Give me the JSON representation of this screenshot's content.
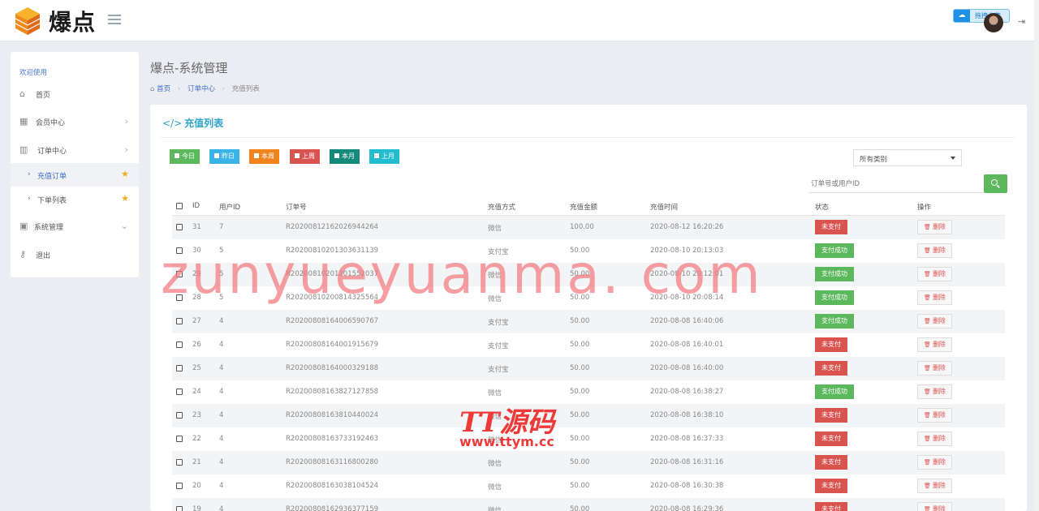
{
  "header": {
    "logo_text": "爆点",
    "upload_label": "拖拽上传",
    "logout_icon": "logout-icon"
  },
  "sidebar": {
    "welcome": "欢迎使用",
    "items": [
      {
        "label": "首页",
        "icon": "home-icon"
      },
      {
        "label": "会员中心",
        "icon": "table-icon"
      },
      {
        "label": "订单中心",
        "icon": "bar-chart-icon"
      },
      {
        "label": "系统管理",
        "icon": "window-icon"
      },
      {
        "label": "退出",
        "icon": "key-icon"
      }
    ],
    "sub_items": [
      {
        "label": "充值订单",
        "active": true
      },
      {
        "label": "下单列表",
        "active": false
      }
    ]
  },
  "page": {
    "title": "爆点-系统管理",
    "breadcrumb": {
      "home": "首页",
      "section": "订单中心",
      "current": "充值列表"
    }
  },
  "panel": {
    "title": "充值列表",
    "filters": [
      {
        "label": "今日",
        "color": "#5cb85c"
      },
      {
        "label": "昨日",
        "color": "#3ab4e6"
      },
      {
        "label": "本周",
        "color": "#f0831e"
      },
      {
        "label": "上周",
        "color": "#d9534f"
      },
      {
        "label": "本月",
        "color": "#138a7c"
      },
      {
        "label": "上月",
        "color": "#24bccf"
      }
    ],
    "type_select": "所有类别",
    "search_placeholder": "订单号或用户ID",
    "columns": [
      "ID",
      "用户ID",
      "订单号",
      "充值方式",
      "充值金额",
      "充值时间",
      "状态",
      "操作"
    ],
    "delete_label": "删除",
    "rows": [
      {
        "id": "31",
        "uid": "7",
        "order": "R20200812162026944264",
        "method": "微信",
        "amount": "100.00",
        "time": "2020-08-12 16:20:26",
        "status": "未支付",
        "paid": false
      },
      {
        "id": "30",
        "uid": "5",
        "order": "R20200810201303631139",
        "method": "支付宝",
        "amount": "50.00",
        "time": "2020-08-10 20:13:03",
        "status": "支付成功",
        "paid": true
      },
      {
        "id": "29",
        "uid": "5",
        "order": "R20200810201201552037",
        "method": "微信",
        "amount": "50.00",
        "time": "2020-08-10 20:12:01",
        "status": "支付成功",
        "paid": true
      },
      {
        "id": "28",
        "uid": "5",
        "order": "R20200810200814325564",
        "method": "微信",
        "amount": "50.00",
        "time": "2020-08-10 20:08:14",
        "status": "支付成功",
        "paid": true
      },
      {
        "id": "27",
        "uid": "4",
        "order": "R20200808164006590767",
        "method": "支付宝",
        "amount": "50.00",
        "time": "2020-08-08 16:40:06",
        "status": "支付成功",
        "paid": true
      },
      {
        "id": "26",
        "uid": "4",
        "order": "R20200808164001915679",
        "method": "支付宝",
        "amount": "50.00",
        "time": "2020-08-08 16:40:01",
        "status": "未支付",
        "paid": false
      },
      {
        "id": "25",
        "uid": "4",
        "order": "R20200808164000329188",
        "method": "支付宝",
        "amount": "50.00",
        "time": "2020-08-08 16:40:00",
        "status": "未支付",
        "paid": false
      },
      {
        "id": "24",
        "uid": "4",
        "order": "R20200808163827127858",
        "method": "微信",
        "amount": "50.00",
        "time": "2020-08-08 16:38:27",
        "status": "支付成功",
        "paid": true
      },
      {
        "id": "23",
        "uid": "4",
        "order": "R20200808163810440024",
        "method": "微信",
        "amount": "50.00",
        "time": "2020-08-08 16:38:10",
        "status": "未支付",
        "paid": false
      },
      {
        "id": "22",
        "uid": "4",
        "order": "R20200808163733192463",
        "method": "微信",
        "amount": "50.00",
        "time": "2020-08-08 16:37:33",
        "status": "未支付",
        "paid": false
      },
      {
        "id": "21",
        "uid": "4",
        "order": "R20200808163116800280",
        "method": "微信",
        "amount": "50.00",
        "time": "2020-08-08 16:31:16",
        "status": "未支付",
        "paid": false
      },
      {
        "id": "20",
        "uid": "4",
        "order": "R20200808163038104524",
        "method": "微信",
        "amount": "50.00",
        "time": "2020-08-08 16:30:38",
        "status": "未支付",
        "paid": false
      },
      {
        "id": "19",
        "uid": "4",
        "order": "R20200808162936377159",
        "method": "微信",
        "amount": "50.00",
        "time": "2020-08-08 16:29:36",
        "status": "未支付",
        "paid": false
      }
    ]
  },
  "watermarks": {
    "site": "zunyueyuanma. com",
    "brand": "TT源码",
    "brand_url": "www.ttym.cc"
  }
}
